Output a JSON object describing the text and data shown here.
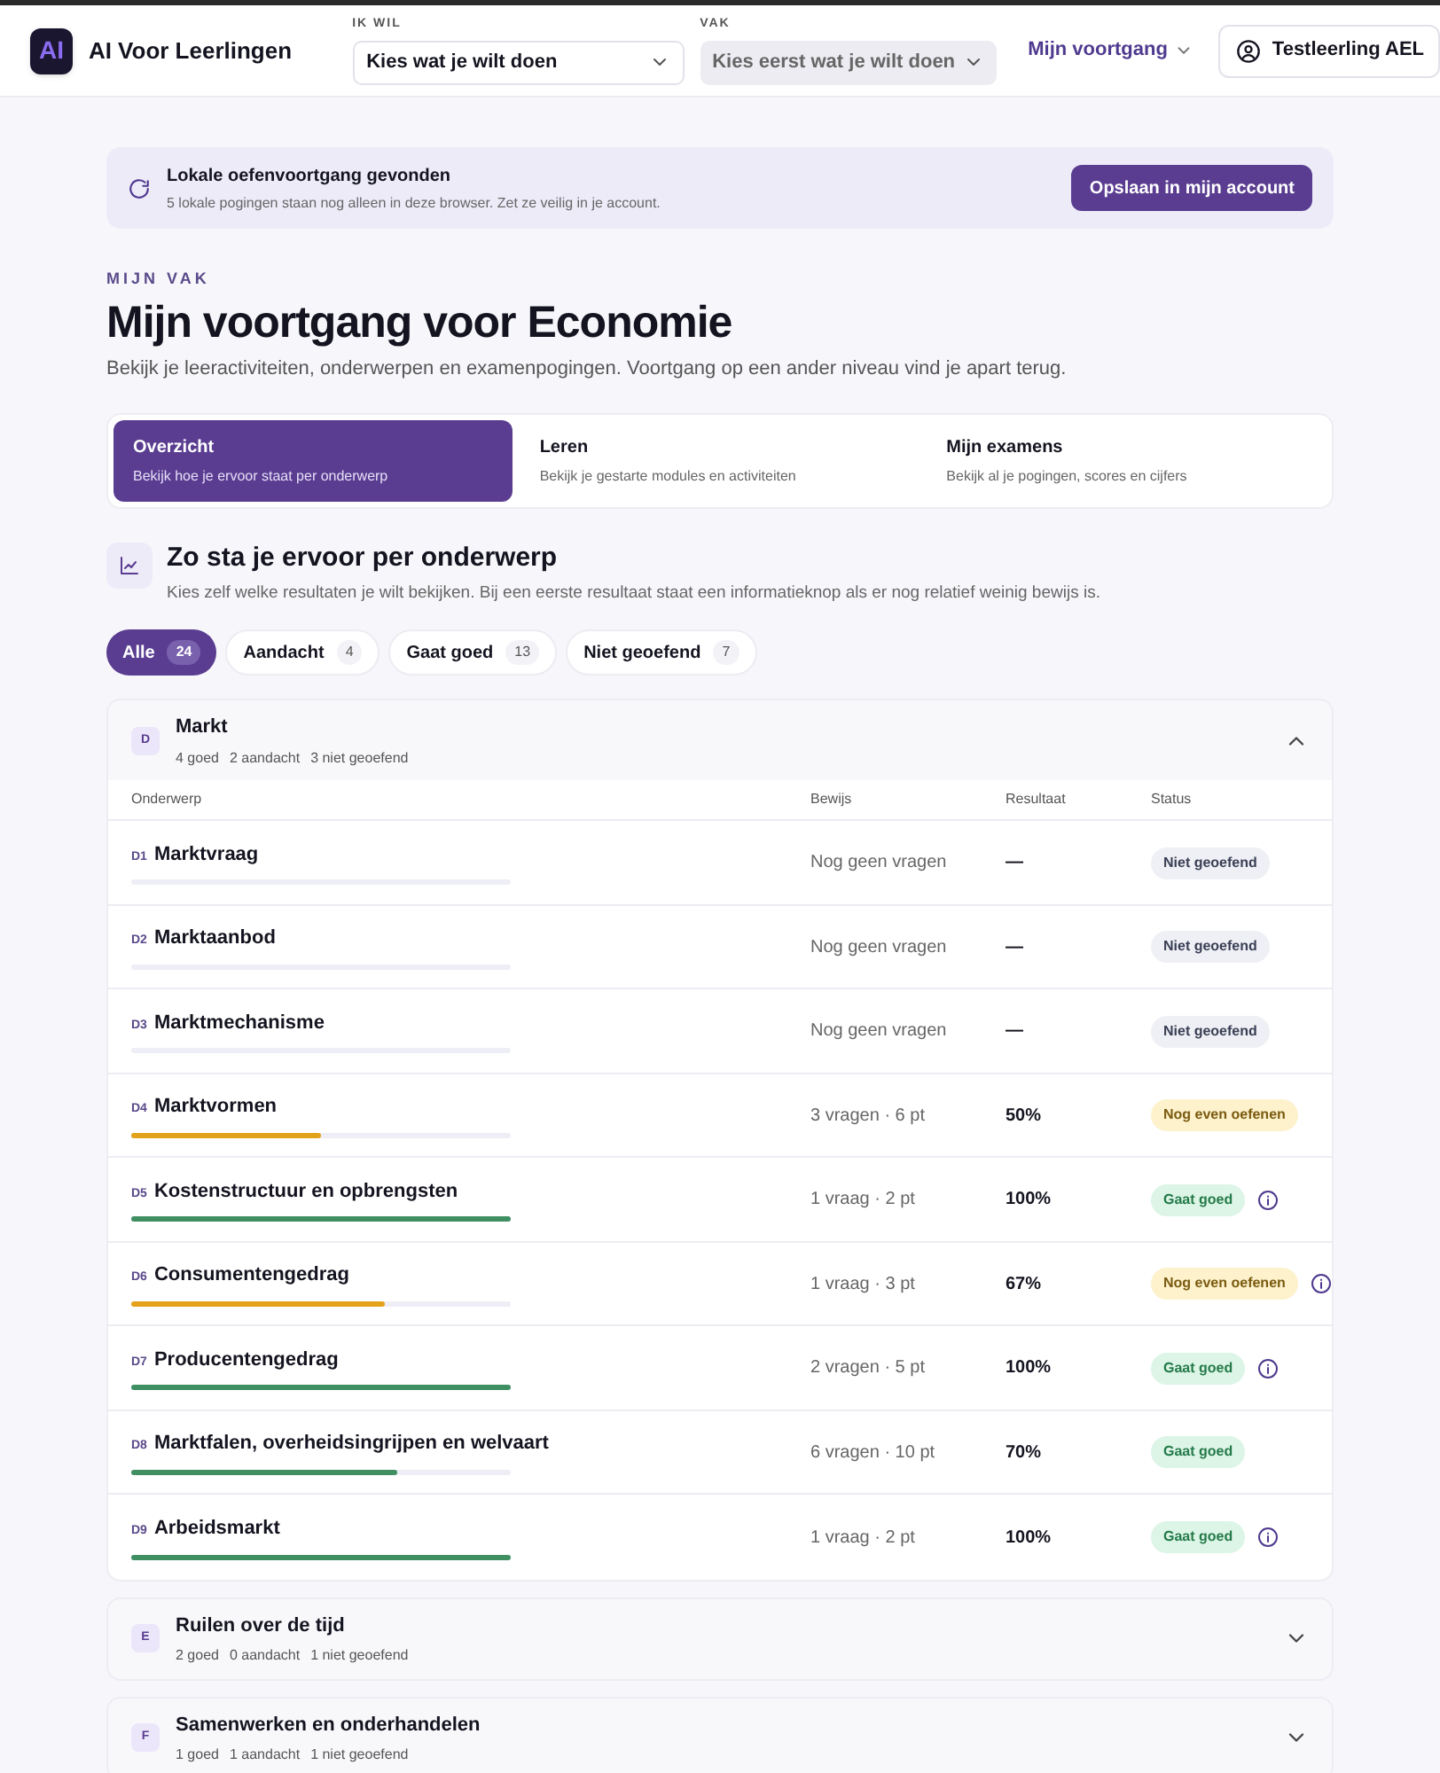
{
  "header": {
    "logo": "AI",
    "app_name": "AI Voor Leerlingen",
    "selects": [
      {
        "label": "IK WIL",
        "value": "Kies wat je wilt doen",
        "disabled": false
      },
      {
        "label": "VAK",
        "value": "Kies eerst wat je wilt doen",
        "disabled": true
      }
    ],
    "progress_menu": "Mijn voortgang",
    "user": "Testleerling AEL"
  },
  "banner": {
    "title": "Lokale oefenvoortgang gevonden",
    "text": "5 lokale pogingen staan nog alleen in deze browser. Zet ze veilig in je account.",
    "button": "Opslaan in mijn account"
  },
  "eyebrow": "MIJN VAK",
  "title": "Mijn voortgang voor Economie",
  "subtitle": "Bekijk je leeractiviteiten, onderwerpen en examenpogingen. Voortgang op een ander niveau vind je apart terug.",
  "tabs": [
    {
      "label": "Overzicht",
      "description": "Bekijk hoe je ervoor staat per onderwerp",
      "selected": true
    },
    {
      "label": "Leren",
      "description": "Bekijk je gestarte modules en activiteiten",
      "selected": false
    },
    {
      "label": "Mijn examens",
      "description": "Bekijk al je pogingen, scores en cijfers",
      "selected": false
    }
  ],
  "section": {
    "title": "Zo sta je ervoor per onderwerp",
    "text": "Kies zelf welke resultaten je wilt bekijken. Bij een eerste resultaat staat een informatieknop als er nog relatief weinig bewijs is."
  },
  "filters": [
    {
      "label": "Alle",
      "count": "24",
      "selected": true
    },
    {
      "label": "Aandacht",
      "count": "4",
      "selected": false
    },
    {
      "label": "Gaat goed",
      "count": "13",
      "selected": false
    },
    {
      "label": "Niet geoefend",
      "count": "7",
      "selected": false
    }
  ],
  "groups": [
    {
      "letter": "D",
      "title": "Markt",
      "stats": [
        "4 goed",
        "2 aandacht",
        "3 niet geoefend"
      ],
      "expanded": true,
      "columns": [
        "Onderwerp",
        "Bewijs",
        "Resultaat",
        "Status"
      ],
      "rows": [
        {
          "code": "D1",
          "name": "Marktvraag",
          "evidence": "Nog geen vragen",
          "result": "—",
          "status": "Niet geoefend",
          "kind": "none",
          "level": 0,
          "info": false
        },
        {
          "code": "D2",
          "name": "Marktaanbod",
          "evidence": "Nog geen vragen",
          "result": "—",
          "status": "Niet geoefend",
          "kind": "none",
          "level": 0,
          "info": false
        },
        {
          "code": "D3",
          "name": "Marktmechanisme",
          "evidence": "Nog geen vragen",
          "result": "—",
          "status": "Niet geoefend",
          "kind": "none",
          "level": 0,
          "info": false
        },
        {
          "code": "D4",
          "name": "Marktvormen",
          "evidence": "3 vragen · 6 pt",
          "result": "50%",
          "status": "Nog even oefenen",
          "kind": "practice",
          "level": 0.5,
          "info": false
        },
        {
          "code": "D5",
          "name": "Kostenstructuur en opbrengsten",
          "evidence": "1 vraag · 2 pt",
          "result": "100%",
          "status": "Gaat goed",
          "kind": "good",
          "level": 1,
          "info": true
        },
        {
          "code": "D6",
          "name": "Consumentengedrag",
          "evidence": "1 vraag · 3 pt",
          "result": "67%",
          "status": "Nog even oefenen",
          "kind": "practice",
          "level": 0.67,
          "info": true
        },
        {
          "code": "D7",
          "name": "Producentengedrag",
          "evidence": "2 vragen · 5 pt",
          "result": "100%",
          "status": "Gaat goed",
          "kind": "good",
          "level": 1,
          "info": true
        },
        {
          "code": "D8",
          "name": "Marktfalen, overheidsingrijpen en welvaart",
          "evidence": "6 vragen · 10 pt",
          "result": "70%",
          "status": "Gaat goed",
          "kind": "good",
          "level": 0.7,
          "info": false
        },
        {
          "code": "D9",
          "name": "Arbeidsmarkt",
          "evidence": "1 vraag · 2 pt",
          "result": "100%",
          "status": "Gaat goed",
          "kind": "good",
          "level": 1,
          "info": true
        }
      ]
    },
    {
      "letter": "E",
      "title": "Ruilen over de tijd",
      "stats": [
        "2 goed",
        "0 aandacht",
        "1 niet geoefend"
      ],
      "expanded": false
    },
    {
      "letter": "F",
      "title": "Samenwerken en onderhandelen",
      "stats": [
        "1 goed",
        "1 aandacht",
        "1 niet geoefend"
      ],
      "expanded": false
    }
  ]
}
